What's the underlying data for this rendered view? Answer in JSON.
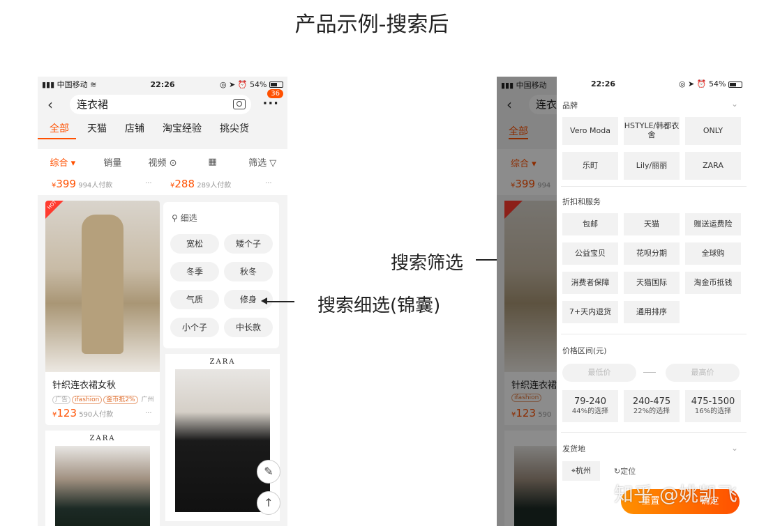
{
  "title": "产品示例-搜索后",
  "phone1": {
    "status": {
      "carrier": "中国移动",
      "time": "22:26",
      "battery": "54%"
    },
    "search_text": "连衣裙",
    "badge": "36",
    "tabs": [
      "全部",
      "天猫",
      "店铺",
      "淘宝经验",
      "挑尖货"
    ],
    "sort": [
      "综合",
      "销量",
      "视频",
      "筛选"
    ],
    "top_prices": [
      {
        "price": "399",
        "sold": "994人付款"
      },
      {
        "price": "288",
        "sold": "289人付款"
      }
    ],
    "hot": "HOT",
    "product": {
      "name": "针织连衣裙女秋",
      "tag_ad": "广告",
      "tag_brand": "ifashion",
      "tag_coin": "金币抵2%",
      "city": "广州",
      "price": "123",
      "sold": "590人付款"
    },
    "refine": {
      "title": "细选",
      "chips": [
        "宽松",
        "矮个子",
        "冬季",
        "秋冬",
        "气质",
        "修身",
        "小个子",
        "中长款"
      ]
    },
    "brand_zara": "ZARA",
    "currency": "¥",
    "dots": "···"
  },
  "annotations": {
    "refine_label": "搜索细选(锦囊)",
    "filter_label": "搜索筛选"
  },
  "phone2": {
    "status": {
      "carrier": "中国移动",
      "time": "22:26",
      "battery": "54%"
    },
    "behind": {
      "search": "连衣",
      "tab": "全部",
      "sort": "综合",
      "price": "399",
      "sold": "994",
      "name": "针织连衣裙",
      "tag": "ifashion",
      "price2": "123",
      "sold2": "590"
    },
    "brand_title": "品牌",
    "brands": [
      "Vero Moda",
      "HSTYLE/韩都衣舍",
      "ONLY",
      "乐町",
      "Lily/丽丽",
      "ZARA"
    ],
    "service_title": "折扣和服务",
    "services": [
      "包邮",
      "天猫",
      "赠送运费险",
      "公益宝贝",
      "花呗分期",
      "全球购",
      "消费者保障",
      "天猫国际",
      "淘金币抵钱",
      "7+天内退货",
      "通用排序"
    ],
    "price_title": "价格区间(元)",
    "price_min": "最低价",
    "price_max": "最高价",
    "ranges": [
      {
        "range": "79-240",
        "pct": "44%的选择"
      },
      {
        "range": "240-475",
        "pct": "22%的选择"
      },
      {
        "range": "475-1500",
        "pct": "16%的选择"
      }
    ],
    "ship_title": "发货地",
    "ship_city": "杭州",
    "locate": "定位",
    "reset": "重置",
    "confirm": "确定"
  },
  "watermark": "知乎 @姚凯飞"
}
